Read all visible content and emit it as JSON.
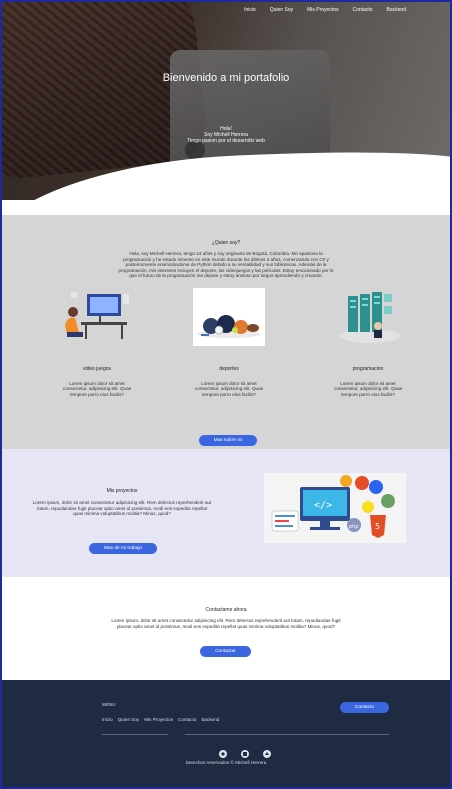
{
  "nav": {
    "items": [
      {
        "label": "Inicio"
      },
      {
        "label": "Quien Soy"
      },
      {
        "label": "Mis Proyectos"
      },
      {
        "label": "Contacto"
      },
      {
        "label": "Backend"
      }
    ]
  },
  "hero": {
    "title": "Bienvenido a mi portafolio",
    "line1": "Hola!",
    "line2": "Soy Michell Herrera",
    "line3": "Tengo pasion por el desarrollo web"
  },
  "about": {
    "title": "¿Quien soy?",
    "bio": "Hola, soy Michell Herrera, tengo 24 años y soy originaria de Bogotá, Colombia. Me apasiona la programación y he estado inmerso en este mundo durante los últimos 3 años, comenzando con C# y posteriormente enamorándome de Python debido a su versatilidad y sus bibliotecas. Además de la programación, mis intereses incluyen el deporte, los videojuegos y las películas. Estoy emocionado por lo que el futuro de la programación me depare y estoy ansioso por seguir aprendiendo y creando.",
    "cards": [
      {
        "title": "video juegos",
        "text": "Lorem ipsum dolor sit amet consectetur, adipisicing elit. Quae tempore porro eius facilis?",
        "icon": "gamer-illustration"
      },
      {
        "title": "deportes",
        "text": "Lorem ipsum dolor sit amet consectetur, adipisicing elit. Quae tempore porro eius facilis?",
        "icon": "sports-balls-illustration"
      },
      {
        "title": "programacion",
        "text": "Lorem ipsum dolor sit amet consectetur, adipisicing elit. Quae tempore porro eius facilis?",
        "icon": "server-programming-illustration"
      }
    ],
    "button": "Mas sobre mi"
  },
  "projects": {
    "title": "Mis proyectos",
    "text": "Lorem ipsum, dolor sit amet consectetur adipisicing elit. Rem delectus reprehenderit aut totam, repudiandae fugit placeat optio amet id possimus, modi eos expedita repellat quas minima voluptatibus molitia? Minus, quod?",
    "button": "Mas de mi trabajo",
    "image": "web-technologies-illustration"
  },
  "contact": {
    "title": "Contactame ahora",
    "text": "Lorem ipsum, dolor sit amet consectetur adipisicing elit. Rem delectus reprehenderit aut totam, repudiandae fugit placeat optio amet id possimus, modi eos expedita repellat quas minima voluptatibus molitia? Minus, quod?",
    "button": "Contactar"
  },
  "footer": {
    "menu_title": "MENU",
    "links": [
      {
        "label": "Inicio"
      },
      {
        "label": "Quien Soy"
      },
      {
        "label": "Mis Proyectos"
      },
      {
        "label": "Contacto"
      },
      {
        "label": "Backend"
      }
    ],
    "button": "Contacto",
    "icons": [
      "social-icon-1",
      "social-icon-2",
      "social-icon-3"
    ],
    "copyright": "Derechos reservados © Michell Herrera"
  },
  "colors": {
    "accent": "#3a66e0",
    "about_bg": "#d5d5d5",
    "projects_bg": "#e6e5f5",
    "footer_bg": "#1f2a43",
    "frame": "#1e2a9c"
  }
}
